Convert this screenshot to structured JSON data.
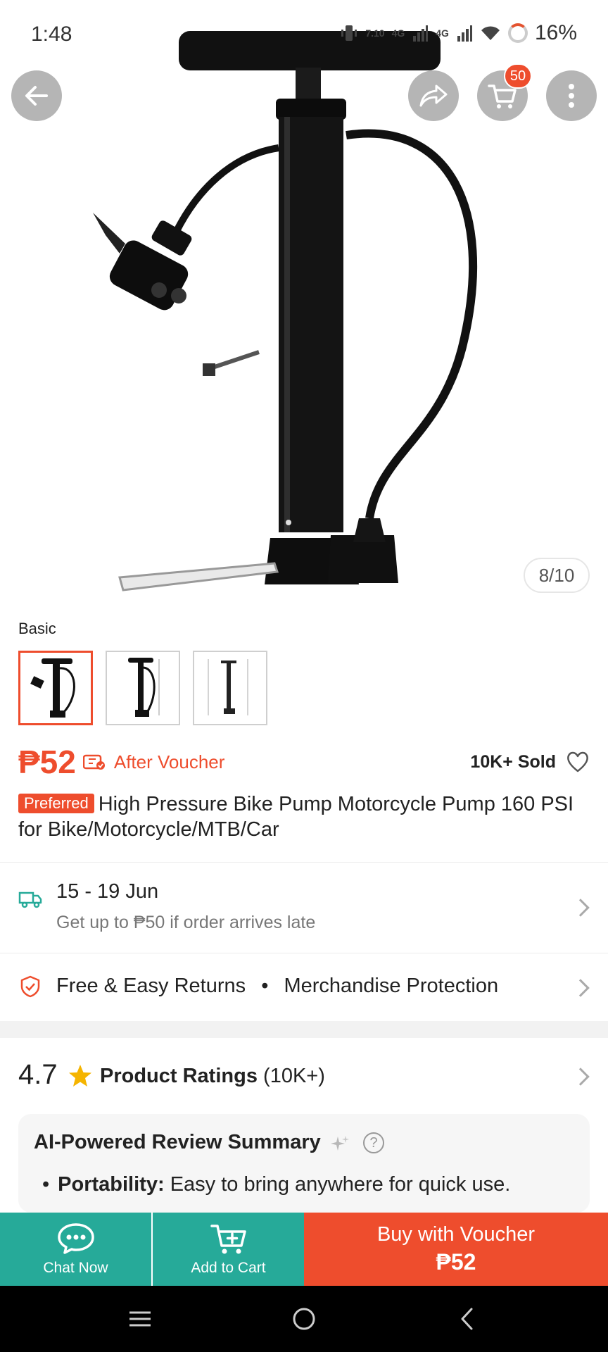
{
  "status_bar": {
    "time": "1:48",
    "net_speed": "7.10",
    "net_type_1": "4G",
    "net_type_2": "4G",
    "battery": "16%"
  },
  "top_actions": {
    "cart_count": "50"
  },
  "gallery": {
    "counter": "8/10"
  },
  "variant": {
    "label": "Basic",
    "thumbnails": [
      "pump-front",
      "pump-side",
      "pump-dimensions"
    ],
    "selected_index": 0
  },
  "price": {
    "amount": "₱52",
    "after_voucher": "After Voucher",
    "sold": "10K+ Sold"
  },
  "product": {
    "badge": "Preferred",
    "title": "High Pressure Bike Pump Motorcycle Pump 160 PSI for Bike/Motorcycle/MTB/Car"
  },
  "delivery": {
    "date_range": "15 - 19 Jun",
    "late_note": "Get up to ₱50 if order arrives late"
  },
  "returns": {
    "text": "Free & Easy Returns",
    "separator": "•",
    "protection": "Merchandise Protection"
  },
  "ratings": {
    "score": "4.7",
    "label": "Product Ratings",
    "count": "(10K+)"
  },
  "ai_summary": {
    "title": "AI-Powered Review Summary",
    "bullet_label": "Portability:",
    "bullet_text": "Easy to bring anywhere for quick use."
  },
  "actions": {
    "chat": "Chat Now",
    "add_to_cart": "Add to Cart",
    "buy_label": "Buy with Voucher",
    "buy_price": "₱52"
  },
  "colors": {
    "accent": "#ee4d2d",
    "green": "#26aa99"
  }
}
